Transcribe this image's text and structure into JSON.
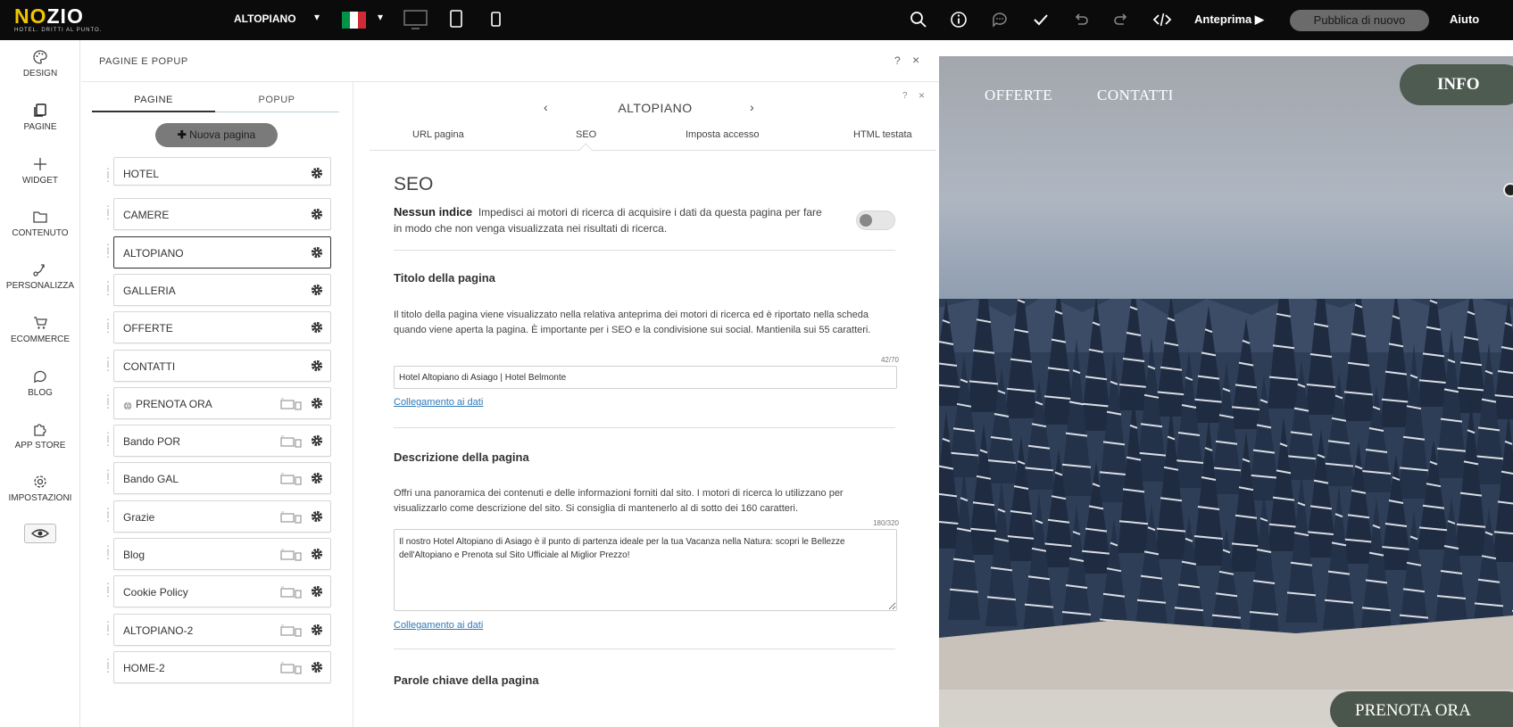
{
  "topbar": {
    "logo_text_a": "NO",
    "logo_text_b": "ZIO",
    "logo_tagline": "HOTEL. DRITTI AL PUNTO.",
    "current_page": "ALTOPIANO",
    "preview_label": "Anteprima ▶",
    "publish_label": "Pubblica di nuovo",
    "help_label": "Aiuto",
    "flag_colors": [
      "#009246",
      "#ffffff",
      "#ce2b37"
    ]
  },
  "rail": {
    "items": [
      {
        "label": "DESIGN",
        "icon": "palette-icon"
      },
      {
        "label": "PAGINE",
        "icon": "pages-icon"
      },
      {
        "label": "WIDGET",
        "icon": "plus-icon"
      },
      {
        "label": "CONTENUTO",
        "icon": "folder-icon"
      },
      {
        "label": "PERSONALIZZA",
        "icon": "customize-icon"
      },
      {
        "label": "ECOMMERCE",
        "icon": "cart-icon"
      },
      {
        "label": "BLOG",
        "icon": "chat-bubble-icon"
      },
      {
        "label": "APP STORE",
        "icon": "puzzle-icon"
      },
      {
        "label": "IMPOSTAZIONI",
        "icon": "gear-icon"
      }
    ]
  },
  "panel": {
    "title": "PAGINE E POPUP",
    "help": "?",
    "close": "×",
    "tabs": [
      "PAGINE",
      "POPUP"
    ],
    "new_page_label": "Nuova pagina",
    "pages": [
      {
        "name": "HOTEL",
        "devices": false,
        "globe": false
      },
      {
        "name": "CAMERE",
        "devices": false,
        "globe": false
      },
      {
        "name": "ALTOPIANO",
        "devices": false,
        "globe": false,
        "active": true
      },
      {
        "name": "GALLERIA",
        "devices": false,
        "globe": false
      },
      {
        "name": "OFFERTE",
        "devices": false,
        "globe": false
      },
      {
        "name": "CONTATTI",
        "devices": false,
        "globe": false
      },
      {
        "name": "PRENOTA ORA",
        "devices": true,
        "globe": true
      },
      {
        "name": "Bando POR",
        "devices": true,
        "globe": false
      },
      {
        "name": "Bando GAL",
        "devices": true,
        "globe": false
      },
      {
        "name": "Grazie",
        "devices": true,
        "globe": false
      },
      {
        "name": "Blog",
        "devices": true,
        "globe": false
      },
      {
        "name": "Cookie Policy",
        "devices": true,
        "globe": false
      },
      {
        "name": "ALTOPIANO-2",
        "devices": true,
        "globe": false
      },
      {
        "name": "HOME-2",
        "devices": true,
        "globe": false
      }
    ]
  },
  "editor": {
    "page_name": "ALTOPIANO",
    "help": "?",
    "close": "×",
    "tabs": [
      "URL pagina",
      "SEO",
      "Imposta accesso",
      "HTML testata"
    ],
    "active_tab": "SEO",
    "heading": "SEO",
    "noindex_title": "Nessun indice",
    "noindex_desc": "Impedisci ai motori di ricerca di acquisire i dati da questa pagina per fare in modo che non venga visualizzata nei risultati di ricerca.",
    "title_section": {
      "label": "Titolo della pagina",
      "desc": "Il titolo della pagina viene visualizzato nella relativa anteprima dei motori di ricerca ed è riportato nella scheda quando viene aperta la pagina. È importante per i SEO e la condivisione sui social. Mantienila sui 55 caratteri.",
      "counter": "42/70",
      "value": "Hotel Altopiano di Asiago | Hotel Belmonte",
      "link": "Collegamento ai dati"
    },
    "desc_section": {
      "label": "Descrizione della pagina",
      "desc": "Offri una panoramica dei contenuti e delle informazioni forniti dal sito. I motori di ricerca lo utilizzano per visualizzarlo come descrizione del sito. Si consiglia di mantenerlo al di sotto dei 160 caratteri.",
      "counter": "180/320",
      "value": "Il nostro Hotel Altopiano di Asiago è il punto di partenza ideale per la tua Vacanza nella Natura: scopri le Bellezze dell'Altopiano e Prenota sul Sito Ufficiale al Miglior Prezzo!",
      "link": "Collegamento ai dati"
    },
    "keywords_label": "Parole chiave della pagina"
  },
  "preview": {
    "nav": [
      "OFFERTE",
      "CONTATTI"
    ],
    "info_label": "INFO",
    "prenota_label": "PRENOTA ORA"
  }
}
